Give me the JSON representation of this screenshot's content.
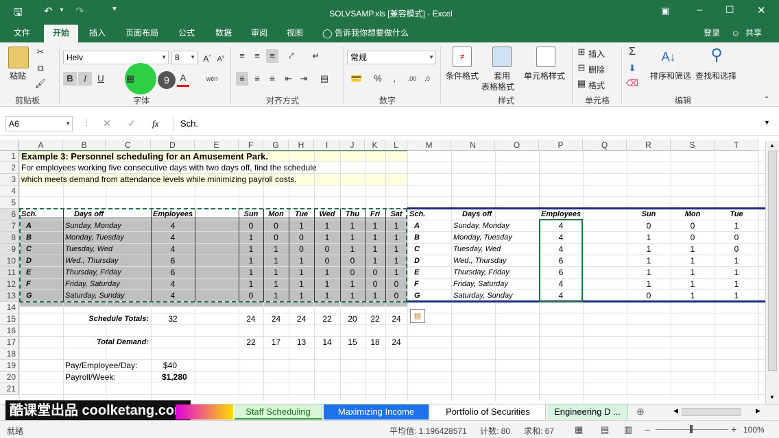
{
  "title": "SOLVSAMP.xls  [兼容模式] - Excel",
  "tabs": [
    "文件",
    "开始",
    "插入",
    "页面布局",
    "公式",
    "数据",
    "审阅",
    "视图"
  ],
  "tell_me": "告诉我你想要做什么",
  "login": "登录",
  "share": "共享",
  "ribbon": {
    "paste": "粘贴",
    "clipboard": "剪贴板",
    "font_name": "Helv",
    "font_size": "8",
    "font_group": "字体",
    "align_group": "对齐方式",
    "number_format": "常规",
    "number_group": "数字",
    "cond_format": "条件格式",
    "table_format_1": "套用",
    "table_format_2": "表格格式",
    "cell_style": "单元格样式",
    "style_group": "样式",
    "insert": "插入",
    "delete": "删除",
    "format": "格式",
    "cells_group": "单元格",
    "sort_filter": "排序和筛选",
    "find_select": "查找和选择",
    "edit_group": "编辑",
    "bold": "B",
    "italic": "I",
    "underline": "U",
    "font_color": "A",
    "wen": "wén",
    "percent": "%",
    "comma": ",",
    "badge": "9"
  },
  "formula_bar": {
    "name_box": "A6",
    "fx": "fx",
    "content": "Sch."
  },
  "col_headers": [
    "A",
    "B",
    "C",
    "D",
    "E",
    "F",
    "G",
    "H",
    "I",
    "J",
    "K",
    "L",
    "M",
    "N",
    "O",
    "P",
    "Q",
    "R",
    "S",
    "T"
  ],
  "row_headers": [
    "1",
    "2",
    "3",
    "4",
    "5",
    "6",
    "7",
    "8",
    "9",
    "10",
    "11",
    "12",
    "13",
    "14",
    "15",
    "16",
    "17",
    "18",
    "19",
    "20",
    "21"
  ],
  "sheet": {
    "r1": "Example 3:  Personnel scheduling for an Amusement Park.",
    "r2": "For employees working five consecutive days with two days off, find the schedule",
    "r3": "which meets demand from attendance levels while minimizing payroll costs.",
    "hdr": {
      "sch": "Sch.",
      "days": "Days off",
      "emp": "Employees",
      "sun": "Sun",
      "mon": "Mon",
      "tue": "Tue",
      "wed": "Wed",
      "thu": "Thu",
      "fri": "Fri",
      "sat": "Sat"
    },
    "rows": [
      {
        "s": "A",
        "d": "Sunday, Monday",
        "e": "4",
        "v": [
          "0",
          "0",
          "1",
          "1",
          "1",
          "1",
          "1"
        ]
      },
      {
        "s": "B",
        "d": "Monday, Tuesday",
        "e": "4",
        "v": [
          "1",
          "0",
          "0",
          "1",
          "1",
          "1",
          "1"
        ]
      },
      {
        "s": "C",
        "d": "Tuesday, Wed",
        "e": "4",
        "v": [
          "1",
          "1",
          "0",
          "0",
          "1",
          "1",
          "1"
        ]
      },
      {
        "s": "D",
        "d": "Wed., Thursday",
        "e": "6",
        "v": [
          "1",
          "1",
          "1",
          "0",
          "0",
          "1",
          "1"
        ]
      },
      {
        "s": "E",
        "d": "Thursday, Friday",
        "e": "6",
        "v": [
          "1",
          "1",
          "1",
          "1",
          "0",
          "0",
          "1"
        ]
      },
      {
        "s": "F",
        "d": "Friday, Saturday",
        "e": "4",
        "v": [
          "1",
          "1",
          "1",
          "1",
          "1",
          "0",
          "0"
        ]
      },
      {
        "s": "G",
        "d": "Saturday, Sunday",
        "e": "4",
        "v": [
          "0",
          "1",
          "1",
          "1",
          "1",
          "1",
          "0"
        ]
      }
    ],
    "totals_label": "Schedule Totals:",
    "totals_emp": "32",
    "totals": [
      "24",
      "24",
      "24",
      "22",
      "20",
      "22",
      "24"
    ],
    "demand_label": "Total Demand:",
    "demand": [
      "22",
      "17",
      "13",
      "14",
      "15",
      "18",
      "24"
    ],
    "pay_label": "Pay/Employee/Day:",
    "pay": "$40",
    "payroll_label": "Payroll/Week:",
    "payroll": "$1,280"
  },
  "sheet_tabs": [
    "Staff Scheduling",
    "Maximizing Income",
    "Portfolio of Securities",
    "Engineering D ..."
  ],
  "watermark": "酷课堂出品 coolketang.com",
  "status": {
    "ready": "就绪",
    "avg": "平均值: 1.196428571",
    "count": "计数: 80",
    "sum": "求和: 67",
    "zoom": "100%"
  }
}
